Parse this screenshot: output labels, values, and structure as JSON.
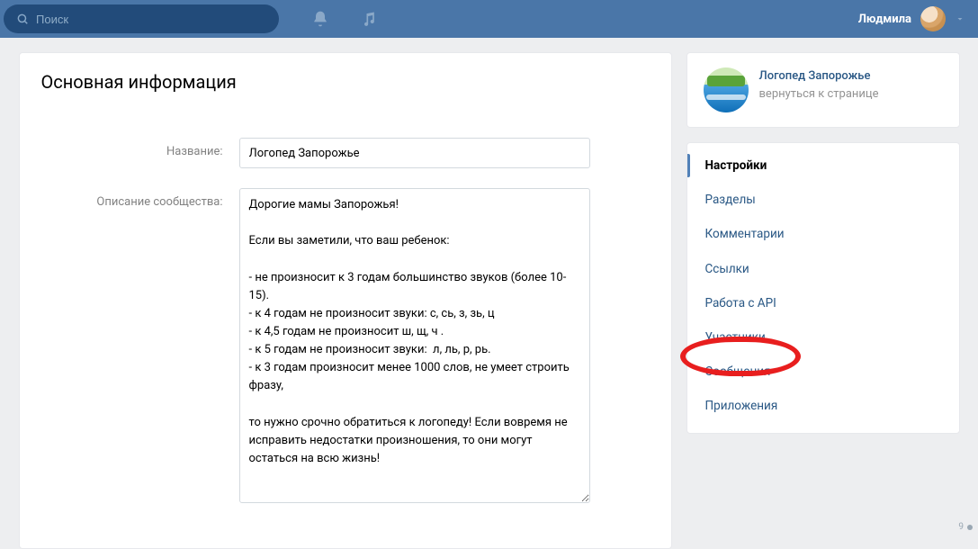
{
  "header": {
    "search_placeholder": "Поиск",
    "user_name": "Людмила"
  },
  "main": {
    "title": "Основная информация",
    "labels": {
      "name": "Название:",
      "description": "Описание сообщества:"
    },
    "values": {
      "name": "Логопед Запорожье",
      "description": "Дорогие мамы Запорожья!\n\nЕсли вы заметили, что ваш ребенок:\n\n- не произносит к 3 годам большинство звуков (более 10-15).\n- к 4 годам не произносит звуки: с, сь, з, зь, ц\n- к 4,5 годам не произносит ш, щ, ч .\n- к 5 годам не произносит звуки:  л, ль, р, рь.\n- к 3 годам произносит менее 1000 слов, не умеет строить фразу,\n\nто нужно срочно обратиться к логопеду! Если вовремя не исправить недостатки произношения, то они могут остаться на всю жизнь!"
    }
  },
  "sidebar": {
    "community": {
      "name": "Логопед Запорожье",
      "back_text": "вернуться к странице"
    },
    "nav": [
      {
        "label": "Настройки",
        "active": true
      },
      {
        "label": "Разделы",
        "active": false
      },
      {
        "label": "Комментарии",
        "active": false
      },
      {
        "label": "Ссылки",
        "active": false
      },
      {
        "label": "Работа с API",
        "active": false
      },
      {
        "label": "Участники",
        "active": false
      },
      {
        "label": "Сообщения",
        "active": false
      },
      {
        "label": "Приложения",
        "active": false
      }
    ]
  },
  "annotation": {
    "circle_target_label": "Участники"
  },
  "status_bar": {
    "text": "9"
  }
}
